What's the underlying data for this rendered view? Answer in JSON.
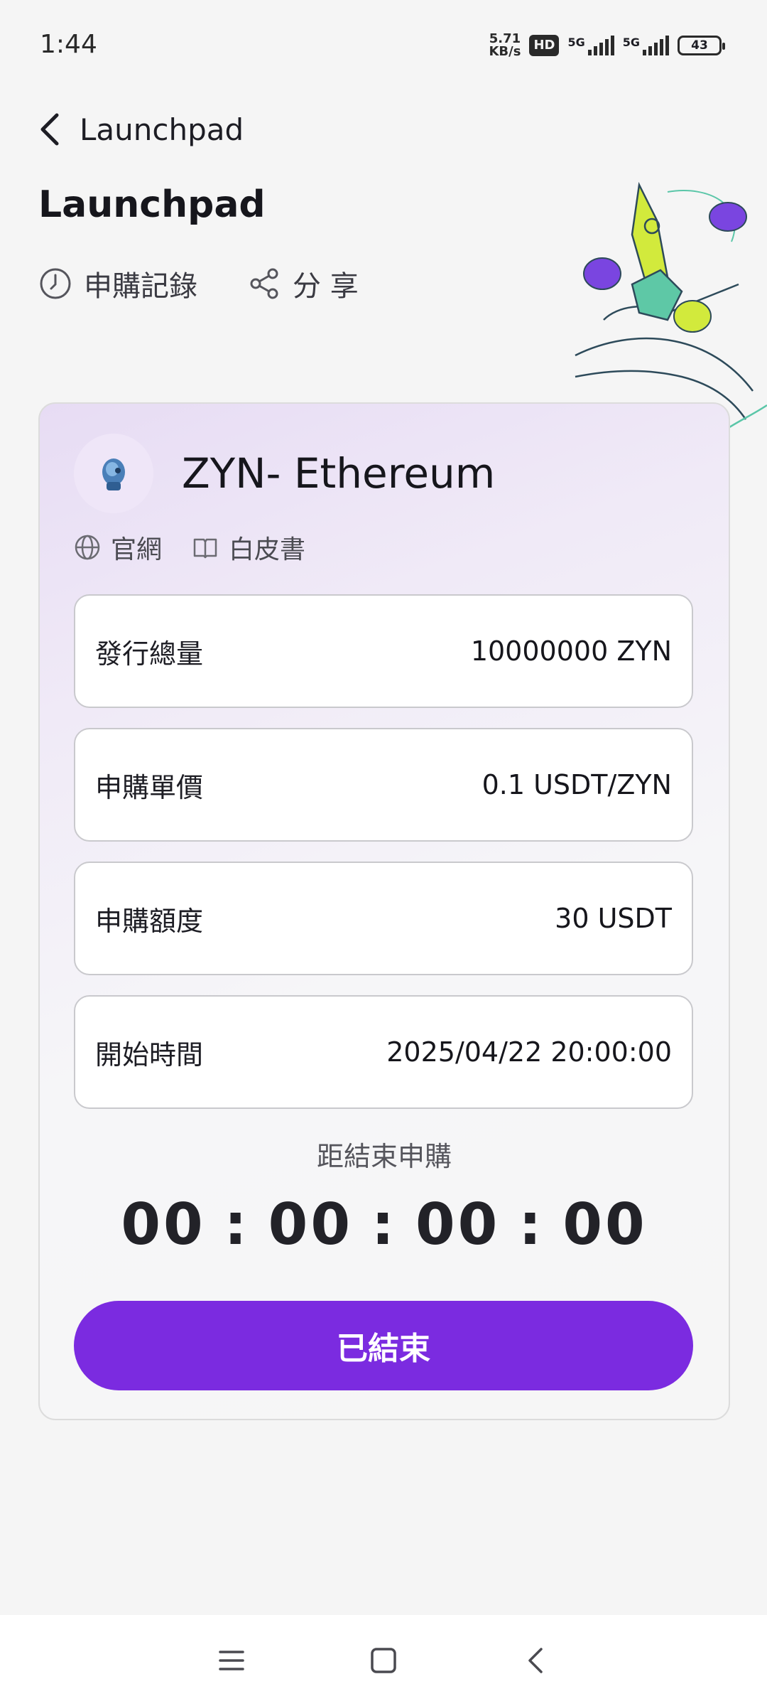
{
  "status_bar": {
    "time": "1:44",
    "net_speed_value": "5.71",
    "net_speed_unit": "KB/s",
    "hd_badge": "HD",
    "signal1_label": "5G",
    "signal2_label": "5G",
    "battery": "43"
  },
  "header": {
    "back_title": "Launchpad",
    "page_title": "Launchpad"
  },
  "actions": {
    "records_label": "申購記錄",
    "share_label": "分 享"
  },
  "token": {
    "name": "ZYN- Ethereum",
    "website_label": "官網",
    "whitepaper_label": "白皮書"
  },
  "info": [
    {
      "label": "發行總量",
      "value": "10000000 ZYN"
    },
    {
      "label": "申購單價",
      "value": "0.1 USDT/ZYN"
    },
    {
      "label": "申購額度",
      "value": "30 USDT"
    },
    {
      "label": "開始時間",
      "value": "2025/04/22 20:00:00"
    }
  ],
  "countdown": {
    "label": "距結束申購",
    "days": "00",
    "hours": "00",
    "minutes": "00",
    "seconds": "00",
    "separator": ":"
  },
  "button": {
    "label": "已結束",
    "color": "#7b2be0"
  },
  "colors": {
    "accent": "#7b2be0",
    "card_gradient_start": "#e7dcf4"
  },
  "icons": {
    "back": "chevron-left-icon",
    "records": "clock-icon",
    "share": "share-icon",
    "website": "globe-icon",
    "whitepaper": "book-icon"
  }
}
